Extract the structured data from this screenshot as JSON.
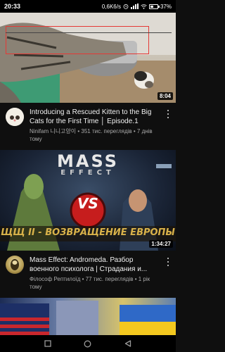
{
  "status": {
    "time": "20:33",
    "speed": "0,6K6/s",
    "battery_text": "37%",
    "battery_level": 0.37
  },
  "videos": [
    {
      "title": "Introducing a Rescued Kitten to the Big Cats for the First Time │ Episode.1",
      "channel_line": "Ninifam 니니고양이 • 351 тис. переглядів • 7 днів тому",
      "duration": "8:04",
      "thumbnail": "cat-and-kitten-photo",
      "avatar": "ninifam-avatar"
    },
    {
      "title": "Mass Effect: Andromeda. Разбор военного психолога | Страдания и...",
      "channel_line": "Філософ Рептилоїд • 77 тис. переглядів • 1 рік тому",
      "duration": "1:34:27",
      "thumbnail": "mass-effect-vs-art",
      "avatar": "reptiloid-avatar",
      "thumb_logo_top": "MASS",
      "thumb_logo_bottom": "EFFECT",
      "thumb_vs": "VS",
      "thumb_banner": "ЩЩ II - ВОЗВРАЩЕНИЕ ЕВРОПЫ"
    },
    {
      "thumbnail": "flags-thumbnail"
    }
  ],
  "nav": {
    "square": "square-icon",
    "circle": "circle-icon",
    "back": "back-triangle-icon"
  },
  "colors": {
    "background": "#0f0f0f",
    "overlay": "#e53935",
    "vs_red": "#c61d1d",
    "me_gold": "#d9b24a"
  }
}
